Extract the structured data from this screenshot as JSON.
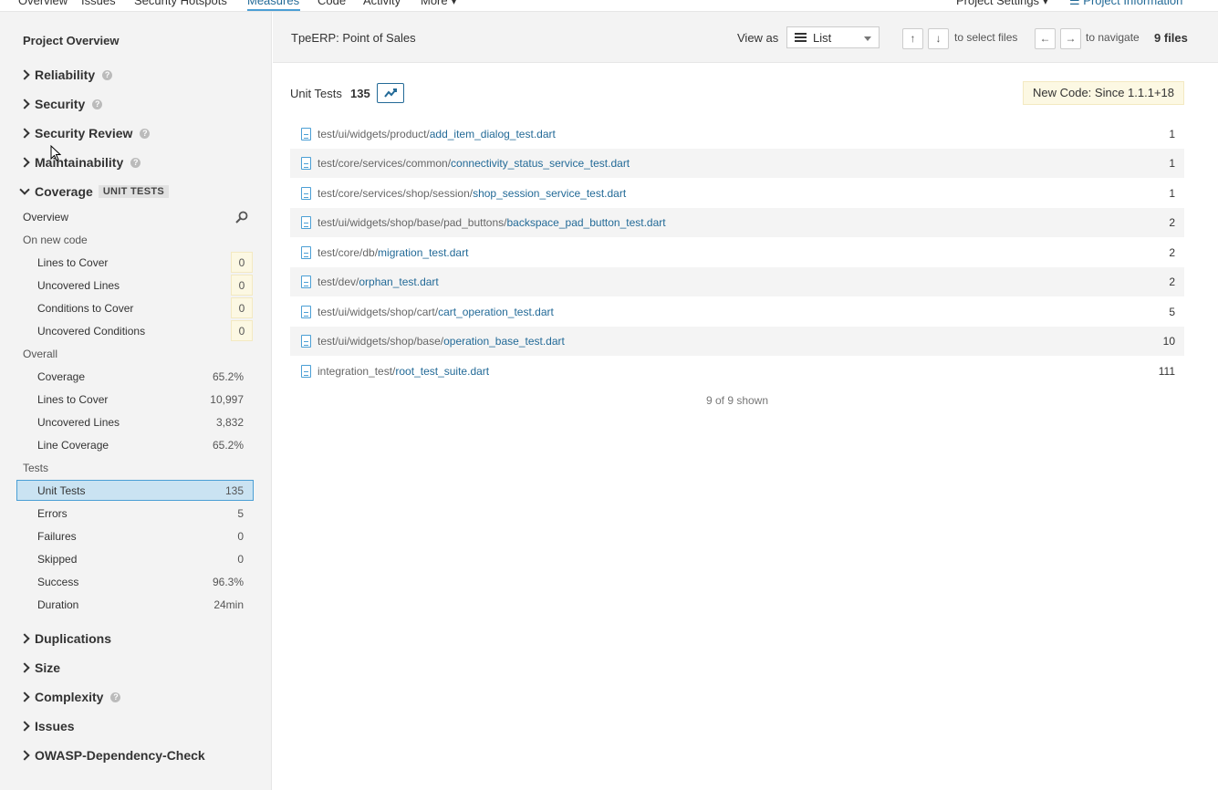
{
  "topnav": {
    "tabs": [
      "Overview",
      "Issues",
      "Security Hotspots",
      "Measures",
      "Code",
      "Activity",
      "More"
    ],
    "active": "Measures",
    "project_settings": "Project Settings",
    "project_information": "Project Information"
  },
  "sidebar": {
    "title": "Project Overview",
    "domains_top": [
      {
        "label": "Reliability",
        "help": true
      },
      {
        "label": "Security",
        "help": true
      },
      {
        "label": "Security Review",
        "help": true
      },
      {
        "label": "Maintainability",
        "help": true
      }
    ],
    "coverage": {
      "label": "Coverage",
      "tag": "UNIT TESTS",
      "overview": "Overview",
      "on_new_code": "On new code",
      "new_code_items": [
        {
          "label": "Lines to Cover",
          "value": "0"
        },
        {
          "label": "Uncovered Lines",
          "value": "0"
        },
        {
          "label": "Conditions to Cover",
          "value": "0"
        },
        {
          "label": "Uncovered Conditions",
          "value": "0"
        }
      ],
      "overall": "Overall",
      "overall_items": [
        {
          "label": "Coverage",
          "value": "65.2%"
        },
        {
          "label": "Lines to Cover",
          "value": "10,997"
        },
        {
          "label": "Uncovered Lines",
          "value": "3,832"
        },
        {
          "label": "Line Coverage",
          "value": "65.2%"
        }
      ],
      "tests": "Tests",
      "test_items": [
        {
          "label": "Unit Tests",
          "value": "135"
        },
        {
          "label": "Errors",
          "value": "5"
        },
        {
          "label": "Failures",
          "value": "0"
        },
        {
          "label": "Skipped",
          "value": "0"
        },
        {
          "label": "Success",
          "value": "96.3%"
        },
        {
          "label": "Duration",
          "value": "24min"
        }
      ]
    },
    "domains_bottom": [
      {
        "label": "Duplications",
        "help": false
      },
      {
        "label": "Size",
        "help": false
      },
      {
        "label": "Complexity",
        "help": true
      },
      {
        "label": "Issues",
        "help": false
      },
      {
        "label": "OWASP-Dependency-Check",
        "help": false
      }
    ]
  },
  "header": {
    "project_name": "TpeERP: Point of Sales",
    "view_as": "View as",
    "view_mode": "List",
    "up_key": "↑",
    "down_key": "↓",
    "select_hint": "to select files",
    "left_key": "←",
    "right_key": "→",
    "navigate_hint": "to navigate",
    "files_count": "9",
    "files_label": "files"
  },
  "content": {
    "metric_title": "Unit Tests",
    "metric_value": "135",
    "new_code": "New Code: Since 1.1.1+18",
    "files": [
      {
        "dir": "test/ui/widgets/product/",
        "name": "add_item_dialog_test.dart",
        "value": "1"
      },
      {
        "dir": "test/core/services/common/",
        "name": "connectivity_status_service_test.dart",
        "value": "1"
      },
      {
        "dir": "test/core/services/shop/session/",
        "name": "shop_session_service_test.dart",
        "value": "1"
      },
      {
        "dir": "test/ui/widgets/shop/base/pad_buttons/",
        "name": "backspace_pad_button_test.dart",
        "value": "2"
      },
      {
        "dir": "test/core/db/",
        "name": "migration_test.dart",
        "value": "2"
      },
      {
        "dir": "test/dev/",
        "name": "orphan_test.dart",
        "value": "2"
      },
      {
        "dir": "test/ui/widgets/shop/cart/",
        "name": "cart_operation_test.dart",
        "value": "5"
      },
      {
        "dir": "test/ui/widgets/shop/base/",
        "name": "operation_base_test.dart",
        "value": "10"
      },
      {
        "dir": "integration_test/",
        "name": "root_test_suite.dart",
        "value": "111"
      }
    ],
    "shown": "9 of 9 shown"
  }
}
